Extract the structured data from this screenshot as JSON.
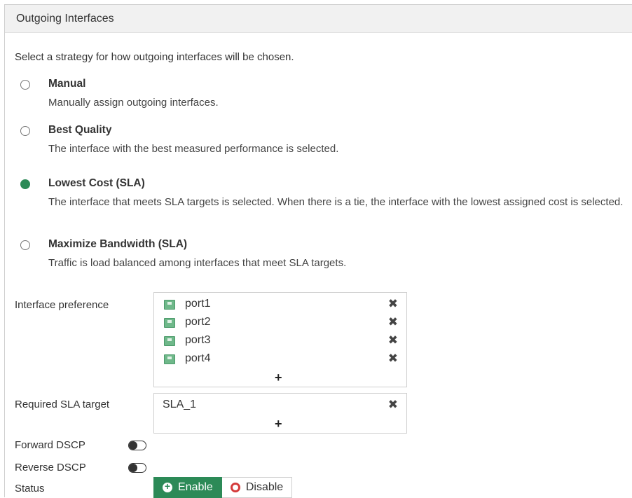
{
  "section": {
    "title": "Outgoing Interfaces",
    "intro": "Select a strategy for how outgoing interfaces will be chosen."
  },
  "strategies": [
    {
      "title": "Manual",
      "desc": "Manually assign outgoing interfaces.",
      "selected": false
    },
    {
      "title": "Best Quality",
      "desc": "The interface with the best measured performance is selected.",
      "selected": false
    },
    {
      "title": "Lowest Cost (SLA)",
      "desc": "The interface that meets SLA targets is selected. When there is a tie, the interface with the lowest assigned cost is selected.",
      "selected": true
    },
    {
      "title": "Maximize Bandwidth (SLA)",
      "desc": "Traffic is load balanced among interfaces that meet SLA targets.",
      "selected": false
    }
  ],
  "interface_preference": {
    "label": "Interface preference",
    "items": [
      "port1",
      "port2",
      "port3",
      "port4"
    ],
    "remove_glyph": "✖",
    "add_glyph": "+"
  },
  "sla_target": {
    "label": "Required SLA target",
    "items": [
      "SLA_1"
    ],
    "remove_glyph": "✖",
    "add_glyph": "+"
  },
  "forward_dscp": {
    "label": "Forward DSCP",
    "enabled": false
  },
  "reverse_dscp": {
    "label": "Reverse DSCP",
    "enabled": false
  },
  "status": {
    "label": "Status",
    "enable_label": "Enable",
    "disable_label": "Disable",
    "value": "Enable"
  },
  "colors": {
    "accent": "#2c8a57",
    "disable_icon": "#d43a3a",
    "header_bg": "#f1f1f1"
  },
  "icons": {
    "port": "port-icon",
    "remove": "close-icon",
    "add": "plus-icon"
  }
}
